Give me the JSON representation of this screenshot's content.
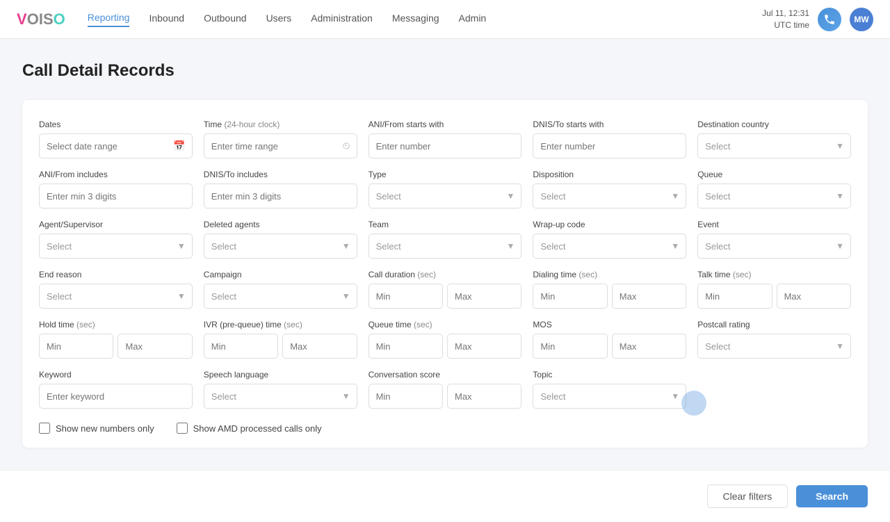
{
  "brand": {
    "v": "V",
    "o1": "O",
    "i": "I",
    "s": "S",
    "o2": "O"
  },
  "nav": {
    "links": [
      {
        "label": "Reporting",
        "active": true
      },
      {
        "label": "Inbound",
        "active": false
      },
      {
        "label": "Outbound",
        "active": false
      },
      {
        "label": "Users",
        "active": false
      },
      {
        "label": "Administration",
        "active": false
      },
      {
        "label": "Messaging",
        "active": false
      },
      {
        "label": "Admin",
        "active": false
      }
    ],
    "datetime": "Jul 11, 12:31",
    "timezone": "UTC time",
    "avatar_initials": "MW"
  },
  "page": {
    "title": "Call Detail Records"
  },
  "filters": {
    "dates_label": "Dates",
    "dates_placeholder": "Select date range",
    "time_label": "Time",
    "time_sub": " (24-hour clock)",
    "time_placeholder": "Enter time range",
    "ani_from_label": "ANI/From starts with",
    "ani_from_placeholder": "Enter number",
    "dnis_to_label": "DNIS/To starts with",
    "dnis_to_placeholder": "Enter number",
    "dest_country_label": "Destination country",
    "dest_country_placeholder": "Select",
    "ani_includes_label": "ANI/From includes",
    "ani_includes_placeholder": "Enter min 3 digits",
    "dnis_includes_label": "DNIS/To includes",
    "dnis_includes_placeholder": "Enter min 3 digits",
    "type_label": "Type",
    "type_placeholder": "Select",
    "disposition_label": "Disposition",
    "disposition_placeholder": "Select",
    "queue_label": "Queue",
    "queue_placeholder": "Select",
    "agent_supervisor_label": "Agent/Supervisor",
    "agent_supervisor_placeholder": "Select",
    "deleted_agents_label": "Deleted agents",
    "deleted_agents_placeholder": "Select",
    "team_label": "Team",
    "team_placeholder": "Select",
    "wrapup_label": "Wrap-up code",
    "wrapup_placeholder": "Select",
    "event_label": "Event",
    "event_placeholder": "Select",
    "end_reason_label": "End reason",
    "end_reason_placeholder": "Select",
    "campaign_label": "Campaign",
    "campaign_placeholder": "Select",
    "call_duration_label": "Call duration",
    "call_duration_sub": " (sec)",
    "dialing_time_label": "Dialing time",
    "dialing_time_sub": " (sec)",
    "talk_time_label": "Talk time",
    "talk_time_sub": " (sec)",
    "hold_time_label": "Hold time",
    "hold_time_sub": " (sec)",
    "ivr_time_label": "IVR (pre-queue) time",
    "ivr_time_sub": " (sec)",
    "queue_time_label": "Queue time",
    "queue_time_sub": " (sec)",
    "mos_label": "MOS",
    "postcall_label": "Postcall rating",
    "postcall_placeholder": "Select",
    "keyword_label": "Keyword",
    "keyword_placeholder": "Enter keyword",
    "speech_lang_label": "Speech language",
    "speech_lang_placeholder": "Select",
    "conv_score_label": "Conversation score",
    "topic_label": "Topic",
    "topic_placeholder": "Select",
    "min_placeholder": "Min",
    "max_placeholder": "Max",
    "show_new_numbers_label": "Show new numbers only",
    "show_amd_label": "Show AMD processed calls only"
  },
  "buttons": {
    "clear": "Clear filters",
    "search": "Search"
  }
}
